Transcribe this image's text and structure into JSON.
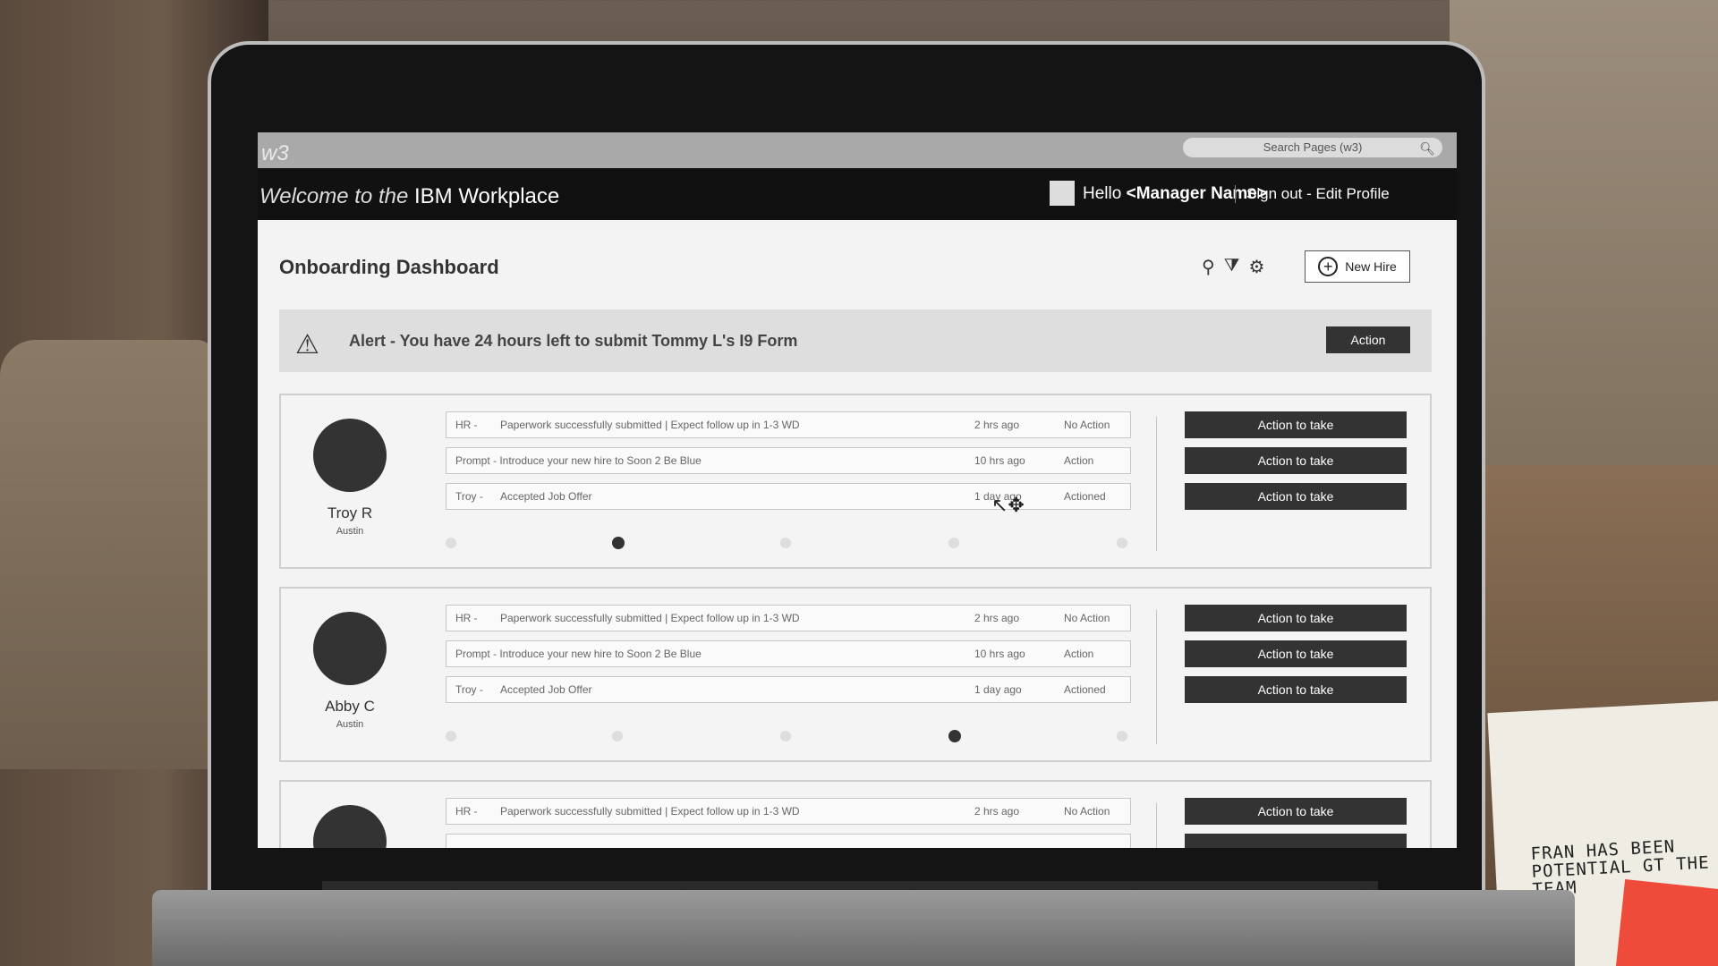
{
  "header": {
    "logo": "w3",
    "search_placeholder": "Search Pages (w3)",
    "welcome_prefix": "Welcome to the",
    "welcome_brand": "IBM Workplace",
    "hello_prefix": "Hello",
    "manager_name": "<Manager Name>",
    "account_links": "Sign out - Edit Profile"
  },
  "dashboard": {
    "title": "Onboarding Dashboard",
    "new_hire_label": "New Hire"
  },
  "alert": {
    "text": "Alert - You have 24 hours left to submit Tommy L's I9 Form",
    "button": "Action"
  },
  "employees": [
    {
      "name": "Troy R",
      "city": "Austin",
      "progress_step": 2,
      "rows": [
        {
          "source": "HR  -",
          "message": "Paperwork successfully submitted | Expect follow up in 1-3 WD",
          "time": "2 hrs ago",
          "status": "No Action"
        },
        {
          "source": "",
          "message": "Prompt - Introduce your new hire to Soon 2 Be Blue",
          "time": "10 hrs ago",
          "status": "Action"
        },
        {
          "source": "Troy  -",
          "message": "Accepted Job Offer",
          "time": "1 day ago",
          "status": "Actioned"
        }
      ],
      "actions": [
        "Action to take",
        "Action to take",
        "Action to take"
      ]
    },
    {
      "name": "Abby C",
      "city": "Austin",
      "progress_step": 4,
      "rows": [
        {
          "source": "HR  -",
          "message": "Paperwork successfully submitted | Expect follow up in 1-3 WD",
          "time": "2 hrs ago",
          "status": "No Action"
        },
        {
          "source": "",
          "message": "Prompt - Introduce your new hire to Soon 2 Be Blue",
          "time": "10 hrs ago",
          "status": "Action"
        },
        {
          "source": "Troy  -",
          "message": "Accepted Job Offer",
          "time": "1 day ago",
          "status": "Actioned"
        }
      ],
      "actions": [
        "Action to take",
        "Action to take",
        "Action to take"
      ]
    },
    {
      "rows": [
        {
          "source": "HR  -",
          "message": "Paperwork successfully submitted | Expect follow up in 1-3 WD",
          "time": "2 hrs ago",
          "status": "No Action"
        }
      ],
      "actions": [
        "Action to take"
      ]
    }
  ],
  "note_text": "FRAN HAS BEEN POTENTIAL GT THE TEAM"
}
